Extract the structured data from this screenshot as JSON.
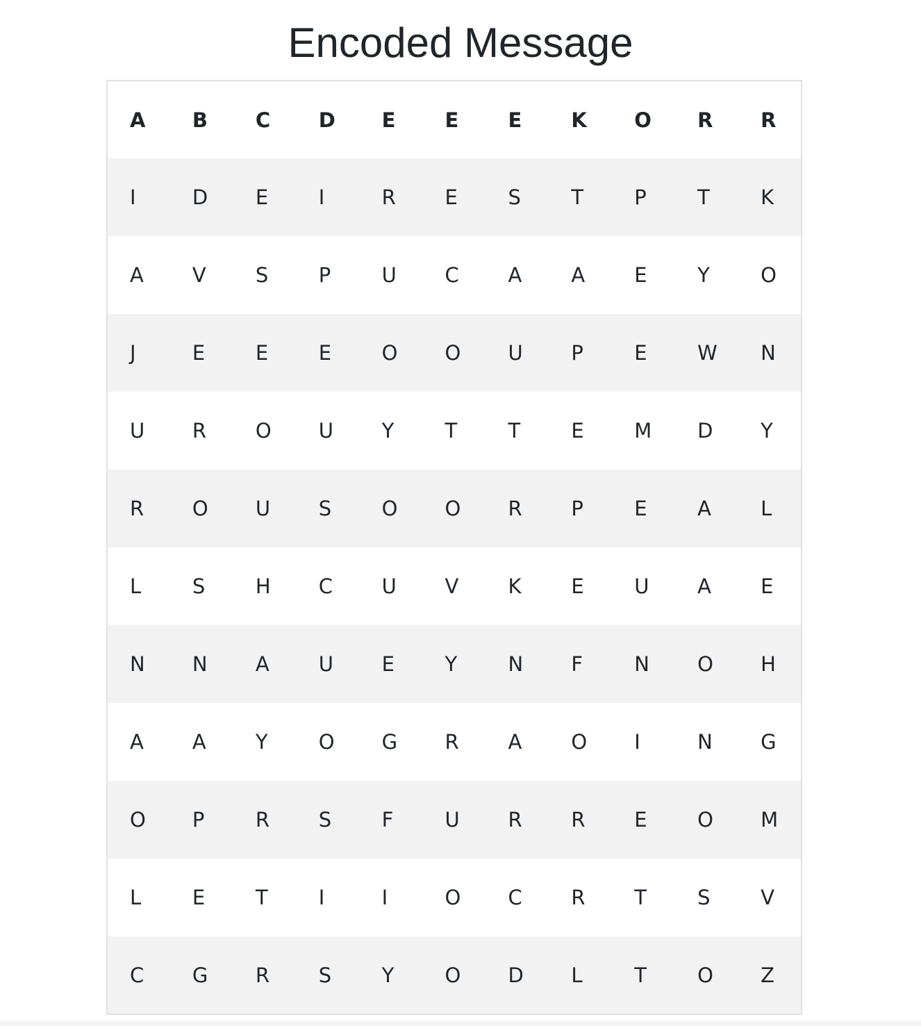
{
  "page": {
    "title": "Encoded Message"
  },
  "table": {
    "headers": [
      "A",
      "B",
      "C",
      "D",
      "E",
      "E",
      "E",
      "K",
      "O",
      "R",
      "R"
    ],
    "rows": [
      [
        "I",
        "D",
        "E",
        "I",
        "R",
        "E",
        "S",
        "T",
        "P",
        "T",
        "K"
      ],
      [
        "A",
        "V",
        "S",
        "P",
        "U",
        "C",
        "A",
        "A",
        "E",
        "Y",
        "O"
      ],
      [
        "J",
        "E",
        "E",
        "E",
        "O",
        "O",
        "U",
        "P",
        "E",
        "W",
        "N"
      ],
      [
        "U",
        "R",
        "O",
        "U",
        "Y",
        "T",
        "T",
        "E",
        "M",
        "D",
        "Y"
      ],
      [
        "R",
        "O",
        "U",
        "S",
        "O",
        "O",
        "R",
        "P",
        "E",
        "A",
        "L"
      ],
      [
        "L",
        "S",
        "H",
        "C",
        "U",
        "V",
        "K",
        "E",
        "U",
        "A",
        "E"
      ],
      [
        "N",
        "N",
        "A",
        "U",
        "E",
        "Y",
        "N",
        "F",
        "N",
        "O",
        "H"
      ],
      [
        "A",
        "A",
        "Y",
        "O",
        "G",
        "R",
        "A",
        "O",
        "I",
        "N",
        "G"
      ],
      [
        "O",
        "P",
        "R",
        "S",
        "F",
        "U",
        "R",
        "R",
        "E",
        "O",
        "M"
      ],
      [
        "L",
        "E",
        "T",
        "I",
        "I",
        "O",
        "C",
        "R",
        "T",
        "S",
        "V"
      ],
      [
        "C",
        "G",
        "R",
        "S",
        "Y",
        "O",
        "D",
        "L",
        "T",
        "O",
        "Z"
      ]
    ]
  },
  "colors": {
    "text": "#212529",
    "stripe": "#f2f2f2",
    "border": "#dee2e6"
  }
}
